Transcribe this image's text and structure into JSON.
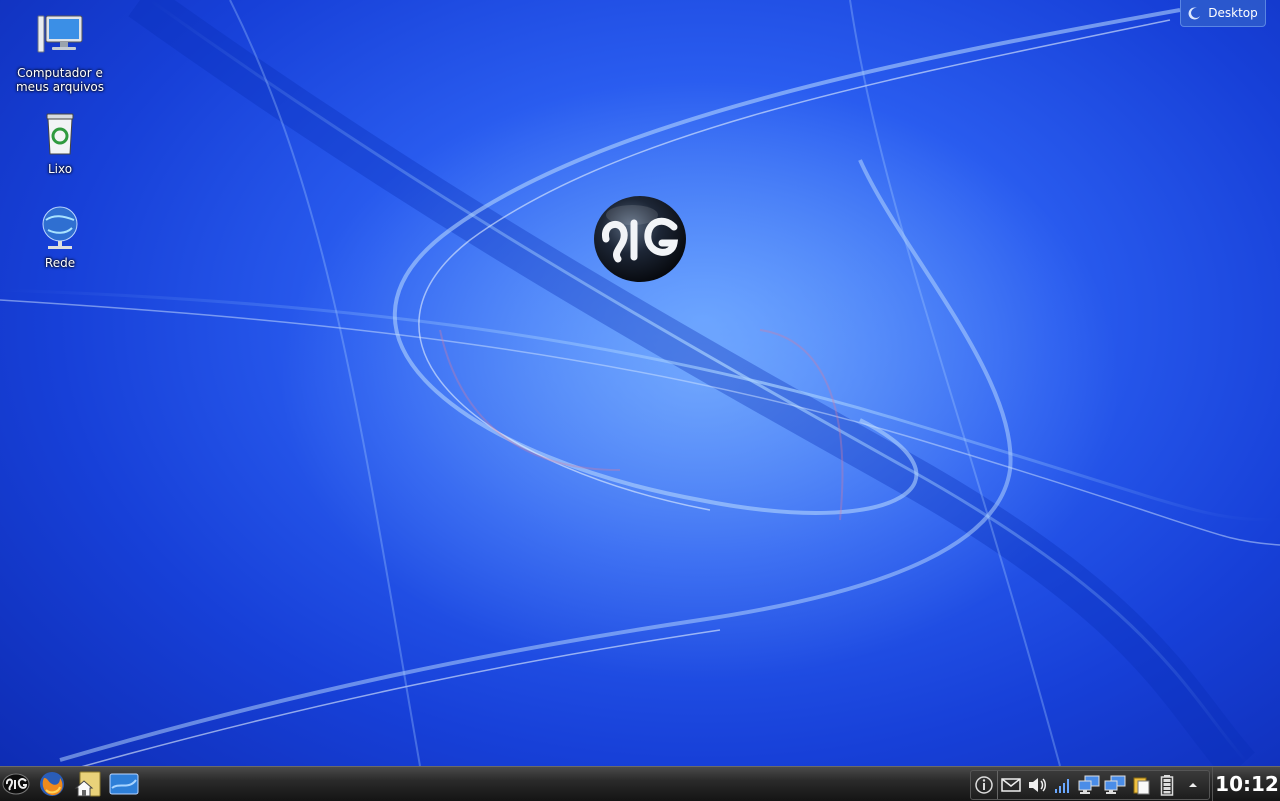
{
  "desktop": {
    "icons": [
      {
        "label": "Computador e meus arquivos",
        "icon": "computer-icon"
      },
      {
        "label": "Lixo",
        "icon": "trash-icon"
      },
      {
        "label": "Rede",
        "icon": "network-globe-icon"
      }
    ],
    "toolbox_label": "Desktop"
  },
  "taskbar": {
    "launcher_icon": "sig-menu-icon",
    "quick_launch": [
      "firefox-icon",
      "home-folder-icon",
      "desktop-show-icon"
    ],
    "tray": [
      "info-icon",
      "mail-icon",
      "volume-icon",
      "signal-icon",
      "network-icon",
      "network-icon",
      "clipboard-icon",
      "battery-icon",
      "expand-arrow-icon"
    ],
    "clock": "10:12"
  },
  "colors": {
    "accent": "#2a5df0",
    "panel": "#1d1d1d"
  }
}
